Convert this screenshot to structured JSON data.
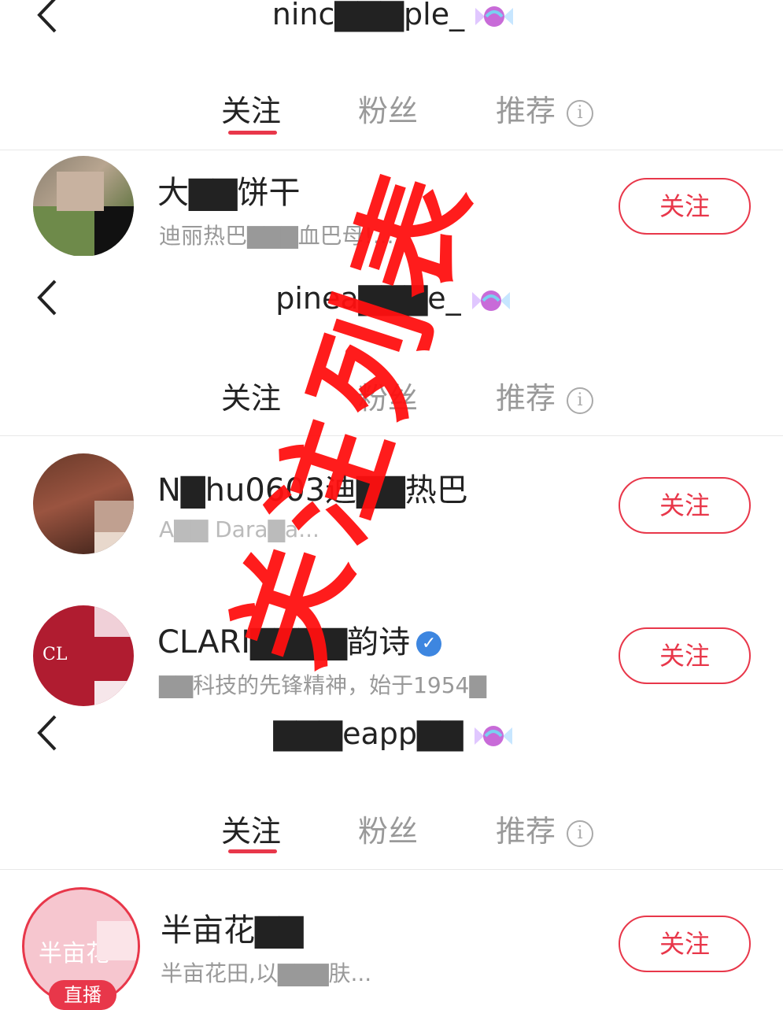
{
  "screens": [
    {
      "title": "ninc▇▇▇ple_",
      "tabs": {
        "following": "关注",
        "fans": "粉丝",
        "recommend": "推荐",
        "info": "i"
      },
      "user": {
        "name": "大▇▇饼干",
        "desc": "迪丽热巴▇▇▇血巴母!...",
        "follow": "关注"
      }
    },
    {
      "title": "pinea▇▇▇e_",
      "tabs": {
        "following": "关注",
        "fans": "粉丝",
        "recommend": "推荐",
        "info": "i"
      },
      "users": [
        {
          "name": "N▇hu0603迪▇▇热巴",
          "desc": "A▇▇ Dara▇a...",
          "follow": "关注"
        },
        {
          "name": "CLARI▇▇▇▇韵诗",
          "verified": "✓",
          "desc": "▇▇科技的先锋精神，始于1954▇",
          "follow": "关注",
          "avatar_text": "CL"
        }
      ]
    },
    {
      "title": "▇▇▇eapp▇▇",
      "tabs": {
        "following": "关注",
        "fans": "粉丝",
        "recommend": "推荐",
        "info": "i"
      },
      "user": {
        "name": "半亩花▇▇",
        "desc": "半亩花田,以▇▇▇肤...",
        "follow": "关注",
        "avatar_text": "半亩花",
        "live": "直播"
      }
    }
  ],
  "watermark": "关注列表",
  "colors": {
    "accent": "#e8374a",
    "watermark": "#ff1010",
    "verified": "#3d86e0"
  }
}
